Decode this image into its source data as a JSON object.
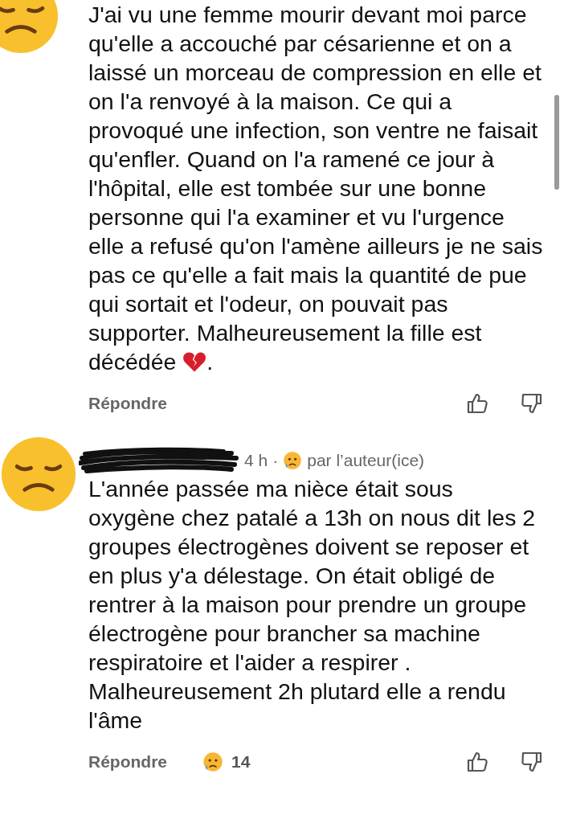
{
  "comments": [
    {
      "body": "J'ai vu une femme mourir devant moi parce qu'elle a accouché par césarienne et on a laissé un morceau de compression en elle et on l'a renvoyé à la maison. Ce qui a provoqué une infection, son ventre ne faisait qu'enfler. Quand on l'a ramené ce jour à l'hôpital, elle est tombée sur une bonne personne qui l'a examiner et vu l'urgence elle a refusé qu'on l'amène ailleurs je ne sais pas ce qu'elle a fait mais la quantité de pue qui sortait et l'odeur, on pouvait pas supporter. Malheureusement la fille est",
      "last_line": {
        "text": "décédée",
        "end": "."
      },
      "reply": "Répondre"
    },
    {
      "age": "4 h",
      "separator": "·",
      "badge": "par l’auteur(ice)",
      "body": "L'année passée ma nièce était sous oxygène chez patalé a 13h on nous dit les 2 groupes électrogènes doivent se reposer et en plus y'a délestage. On était obligé de rentrer à la maison pour prendre un groupe électrogène pour brancher sa machine respiratoire et l'aider a respirer . Malheureusement 2h plutard elle a rendu l'âme",
      "reply": "Répondre",
      "reaction_count": "14"
    }
  ]
}
